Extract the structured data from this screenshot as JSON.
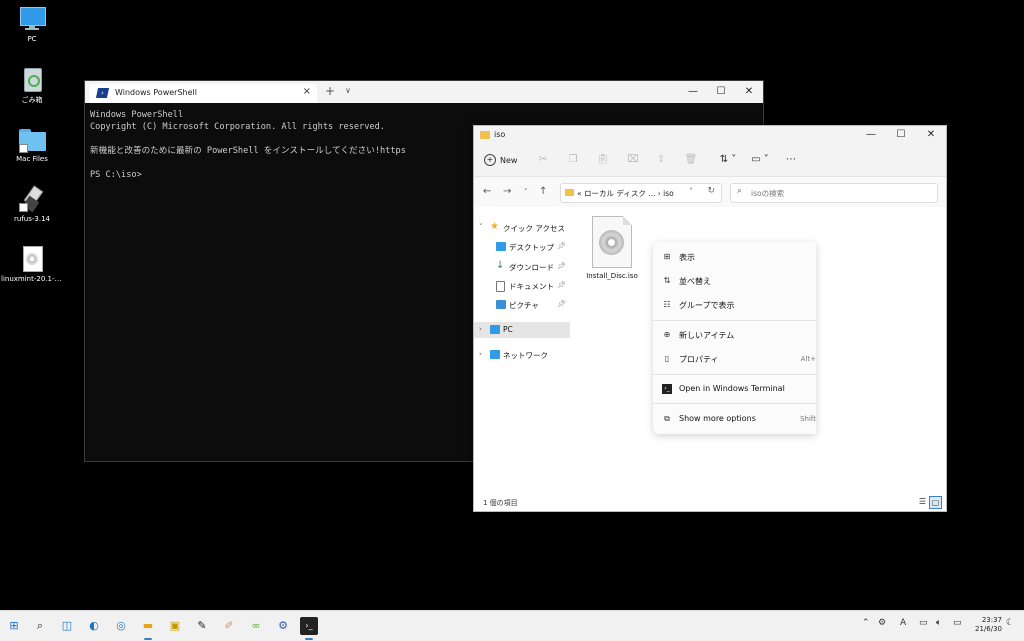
{
  "desktop": {
    "icons": [
      {
        "label": "PC",
        "icon": "monitor-icon"
      },
      {
        "label": "ごみ箱",
        "icon": "recycle-bin-icon"
      },
      {
        "label": "Mac Files",
        "icon": "folder-icon"
      },
      {
        "label": "rufus-3.14",
        "icon": "usb-icon"
      },
      {
        "label": "linuxmint-20.1-x...",
        "icon": "disc-image-icon"
      }
    ]
  },
  "powershell": {
    "tab_title": "Windows PowerShell",
    "lines": [
      "Windows PowerShell",
      "Copyright (C) Microsoft Corporation. All rights reserved.",
      "",
      "新機能と改善のために最新の PowerShell をインストールしてください!https",
      "",
      "PS C:\\iso>"
    ]
  },
  "explorer": {
    "title": "iso",
    "new_label": "New",
    "path_text": "« ローカル ディスク ...  ›  iso",
    "search_placeholder": "isoの検索",
    "nav": {
      "quick_access": "クイック アクセス",
      "desktop": "デスクトップ",
      "downloads": "ダウンロード",
      "documents": "ドキュメント",
      "pictures": "ピクチャ",
      "pc": "PC",
      "network": "ネットワーク"
    },
    "file_name": "Install_Disc.iso",
    "status": "1 個の項目"
  },
  "context_menu": {
    "view": "表示",
    "sort": "並べ替え",
    "group": "グループで表示",
    "new_item": "新しいアイテム",
    "properties": "プロパティ",
    "properties_key": "Alt+",
    "open_terminal": "Open in Windows Terminal",
    "more_options": "Show more options",
    "more_options_key": "Shift"
  },
  "clock": {
    "time": "23:37",
    "date": "21/6/30"
  },
  "colors": {
    "accent": "#3b82c4",
    "folder": "#f3c14b"
  }
}
